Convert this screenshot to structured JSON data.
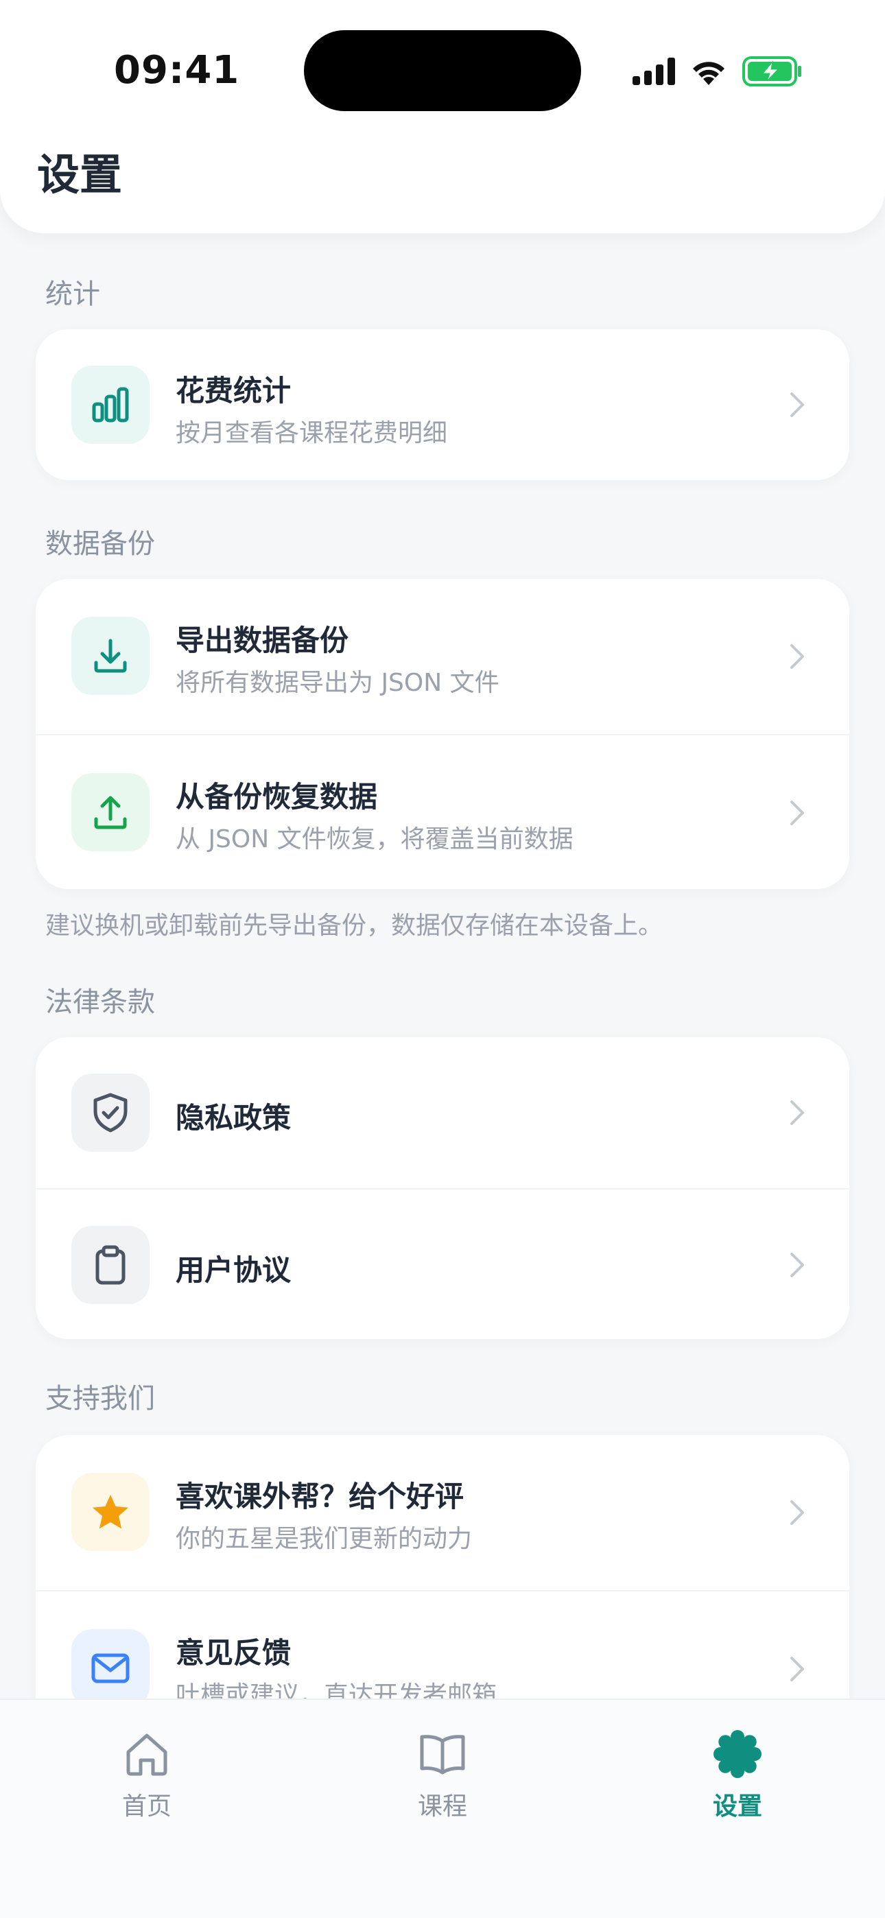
{
  "status_bar": {
    "time": "09:41"
  },
  "header": {
    "title": "设置"
  },
  "sections": {
    "stats": {
      "label": "统计",
      "items": [
        {
          "title": "花费统计",
          "subtitle": "按月查看各课程花费明细",
          "icon": "bar-chart-icon"
        }
      ]
    },
    "backup": {
      "label": "数据备份",
      "items": [
        {
          "title": "导出数据备份",
          "subtitle": "将所有数据导出为 JSON 文件",
          "icon": "download-icon"
        },
        {
          "title": "从备份恢复数据",
          "subtitle": "从 JSON 文件恢复，将覆盖当前数据",
          "icon": "upload-icon"
        }
      ],
      "note": "建议换机或卸载前先导出备份，数据仅存储在本设备上。"
    },
    "legal": {
      "label": "法律条款",
      "items": [
        {
          "title": "隐私政策",
          "icon": "shield-check-icon"
        },
        {
          "title": "用户协议",
          "icon": "clipboard-icon"
        }
      ]
    },
    "support": {
      "label": "支持我们",
      "items": [
        {
          "title": "喜欢课外帮？给个好评",
          "subtitle": "你的五星是我们更新的动力",
          "icon": "star-icon"
        },
        {
          "title": "意见反馈",
          "subtitle": "吐槽或建议，直达开发者邮箱",
          "icon": "mail-icon"
        }
      ]
    }
  },
  "tabbar": {
    "tabs": [
      {
        "label": "首页",
        "icon": "home-icon",
        "active": false
      },
      {
        "label": "课程",
        "icon": "book-icon",
        "active": false
      },
      {
        "label": "设置",
        "icon": "settings-icon",
        "active": true
      }
    ]
  },
  "colors": {
    "accent": "#0f8f80",
    "background": "#f5f7f9",
    "card": "#ffffff",
    "text_secondary": "#9aa1ac",
    "star": "#f59e0b",
    "mail": "#3b82f6"
  }
}
